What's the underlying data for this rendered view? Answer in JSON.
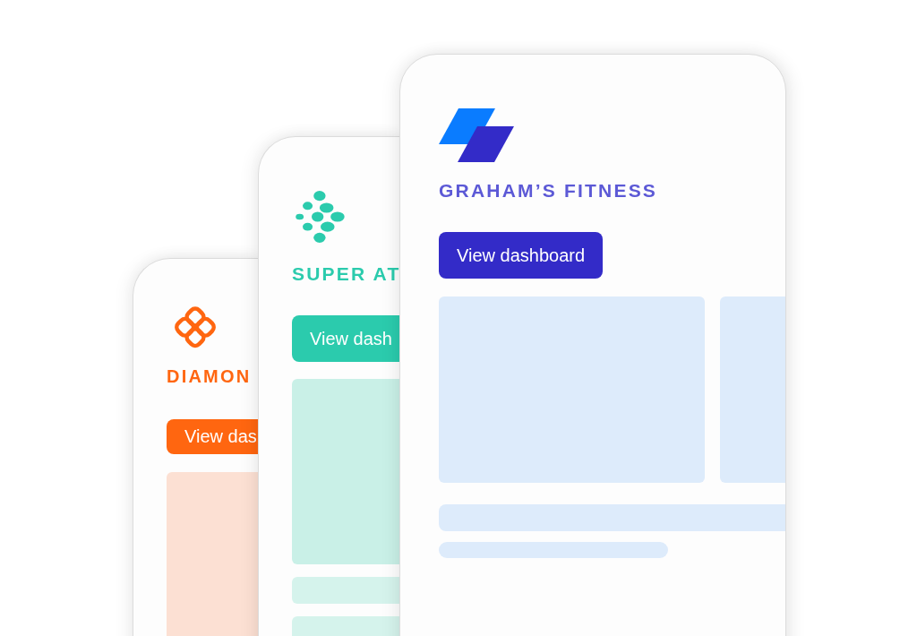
{
  "cards": [
    {
      "kind": "petals",
      "color": "#ff6610",
      "brand": "DIAMON",
      "button": "View das"
    },
    {
      "kind": "dots",
      "color": "#2bcbad",
      "brand": "SUPER AT",
      "button": "View dash"
    },
    {
      "kind": "steps",
      "color": "#332bc8",
      "brand": "GRAHAM’S FITNESS",
      "button": "View dashboard"
    }
  ]
}
